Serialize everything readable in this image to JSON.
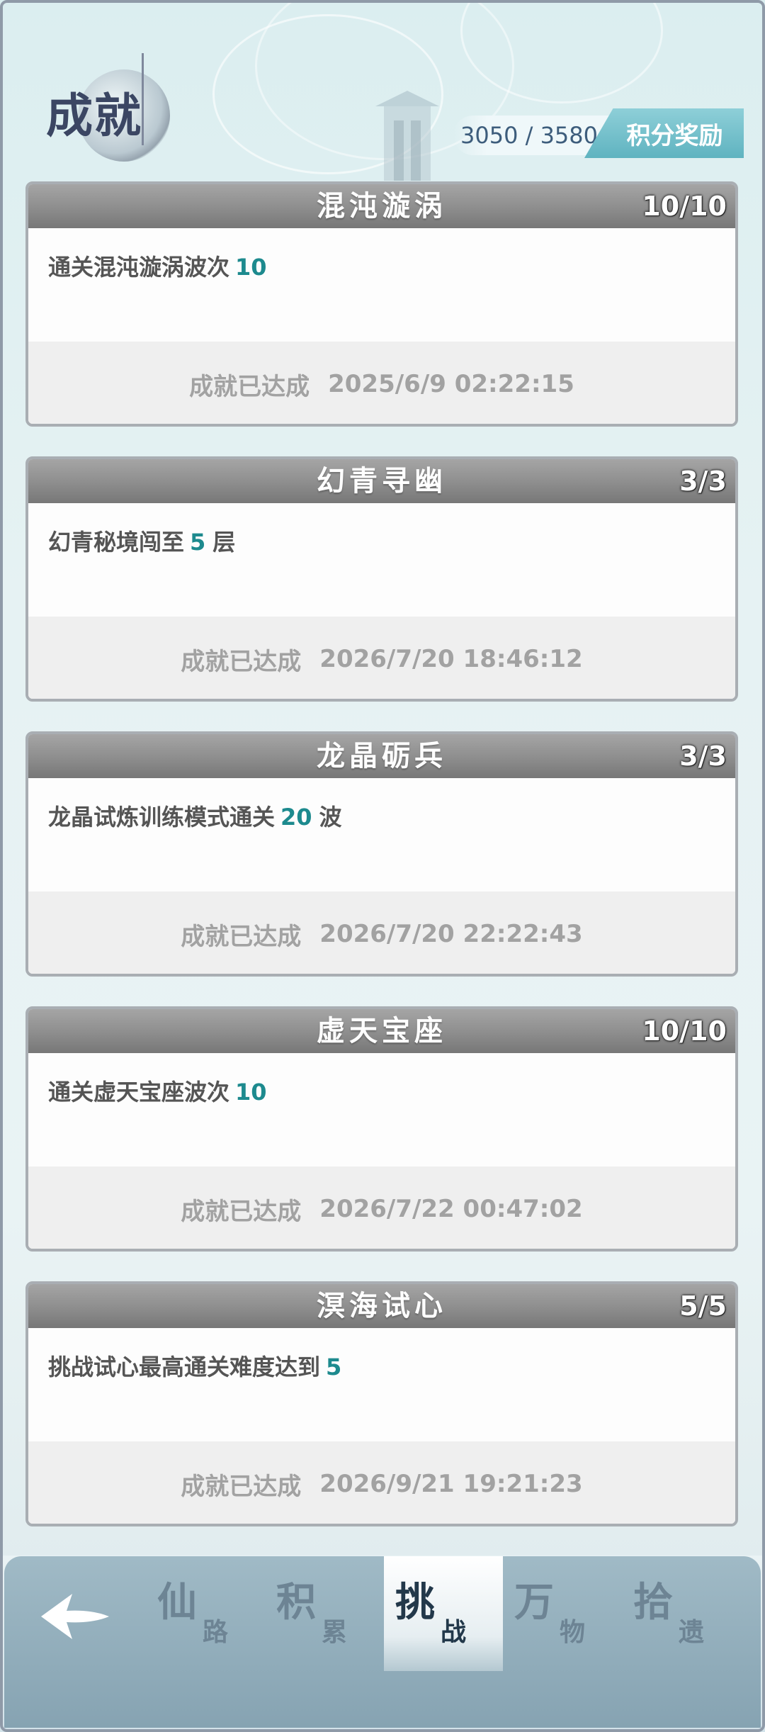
{
  "header": {
    "title": "成就",
    "score": "3050 / 3580",
    "reward_label": "积分奖励"
  },
  "achievements": [
    {
      "title": "混沌漩涡",
      "progress": "10/10",
      "desc": "通关混沌漩涡波次",
      "value": "10",
      "unit": "",
      "status": "成就已达成",
      "time": "2025/6/9 02:22:15"
    },
    {
      "title": "幻青寻幽",
      "progress": "3/3",
      "desc": "幻青秘境闯至",
      "value": "5",
      "unit": "层",
      "status": "成就已达成",
      "time": "2026/7/20 18:46:12"
    },
    {
      "title": "龙晶砺兵",
      "progress": "3/3",
      "desc": "龙晶试炼训练模式通关",
      "value": "20",
      "unit": "波",
      "status": "成就已达成",
      "time": "2026/7/20 22:22:43"
    },
    {
      "title": "虚天宝座",
      "progress": "10/10",
      "desc": "通关虚天宝座波次",
      "value": "10",
      "unit": "",
      "status": "成就已达成",
      "time": "2026/7/22 00:47:02"
    },
    {
      "title": "溟海试心",
      "progress": "5/5",
      "desc": "挑战试心最高通关难度达到",
      "value": "5",
      "unit": "",
      "status": "成就已达成",
      "time": "2026/9/21 19:21:23"
    }
  ],
  "nav": {
    "back_icon": "back-arrow-icon",
    "tabs": [
      {
        "big": "仙",
        "small": "路",
        "active": false
      },
      {
        "big": "积",
        "small": "累",
        "active": false
      },
      {
        "big": "挑",
        "small": "战",
        "active": true
      },
      {
        "big": "万",
        "small": "物",
        "active": false
      },
      {
        "big": "拾",
        "small": "遗",
        "active": false
      }
    ]
  }
}
